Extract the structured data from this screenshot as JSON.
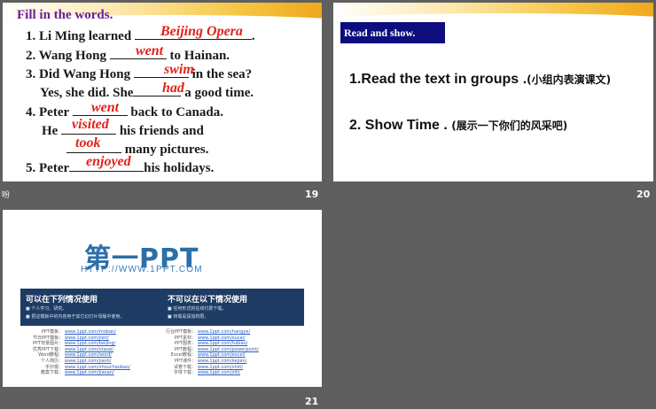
{
  "slides": [
    {
      "number": "19",
      "title": "Fill in the words.",
      "lines": [
        {
          "pre": "1. Li Ming learned",
          "post": ".",
          "answer": "Beijing Opera"
        },
        {
          "pre": "2. Wang Hong",
          "post": "to Hainan.",
          "answer": "went"
        },
        {
          "pre": "3. Did Wang Hong",
          "post": "in the sea?",
          "answer": "swim"
        },
        {
          "pre": "Yes, she did.  She",
          "post": "a good time.",
          "answer": "had"
        },
        {
          "pre": "4. Peter",
          "post": "back to Canada.",
          "answer": "went"
        },
        {
          "pre": "He",
          "post": "his friends and",
          "answer": "visited"
        },
        {
          "pre": "",
          "post": "many pictures.",
          "answer": "took"
        },
        {
          "pre": "5. Peter",
          "post": "his holidays.",
          "answer": "enjoyed"
        }
      ]
    },
    {
      "number": "20",
      "label": "Read and show.",
      "item1": "1.Read the text in groups",
      "item1_zh": ".(小组内表演课文)",
      "item2": "2. Show Time .",
      "item2_zh": "(展示一下你们的风采吧)"
    },
    {
      "number": "21",
      "logo": "第一PPT",
      "url": "HTTP://WWW.1PPT.COM",
      "can_title": "可以在下列情况使用",
      "can_items": [
        "个人学习、研究。",
        "把这模板中的内容用于其它幻灯片母版中使用。"
      ],
      "cannot_title": "不可以在以下情况使用",
      "cannot_items": [
        "任何形式的在线付费下载。",
        "转载是请加权限。"
      ],
      "links_left": [
        {
          "label": "PPT模板：",
          "url": "www.1ppt.com/moban/"
        },
        {
          "label": "节日PPT模板：",
          "url": "www.1ppt.com/jieri/"
        },
        {
          "label": "PPT背景图片：",
          "url": "www.1ppt.com/beijing/"
        },
        {
          "label": "优秀PPT下载：",
          "url": "www.1ppt.com/xiazai/"
        },
        {
          "label": "Word教程：",
          "url": "www.1ppt.com/word/"
        },
        {
          "label": "个人简历：",
          "url": "www.1ppt.com/jianli/"
        },
        {
          "label": "手抄报：",
          "url": "www.1ppt.com/shouchaobao/"
        },
        {
          "label": "教案下载：",
          "url": "www.1ppt.com/jiaoan/"
        }
      ],
      "links_right": [
        {
          "label": "行业PPT模板：",
          "url": "www.1ppt.com/hangye/"
        },
        {
          "label": "PPT素材：",
          "url": "www.1ppt.com/sucai/"
        },
        {
          "label": "PPT图表：",
          "url": "www.1ppt.com/tubiao/"
        },
        {
          "label": "PPT教程：",
          "url": "www.1ppt.com/powerpoint/"
        },
        {
          "label": "Excel教程：",
          "url": "www.1ppt.com/excel/"
        },
        {
          "label": "PPT课件：",
          "url": "www.1ppt.com/kejian/"
        },
        {
          "label": "试卷下载：",
          "url": "www.1ppt.com/shiti/"
        },
        {
          "label": "字体下载：",
          "url": "www.1ppt.com/ziti/"
        }
      ]
    }
  ],
  "side_char": "吩",
  "colors": {
    "title_purple": "#6a1f9a",
    "answer_red": "#e0231b",
    "navy": "#0d0d7e",
    "background": "#5f5f5f"
  }
}
